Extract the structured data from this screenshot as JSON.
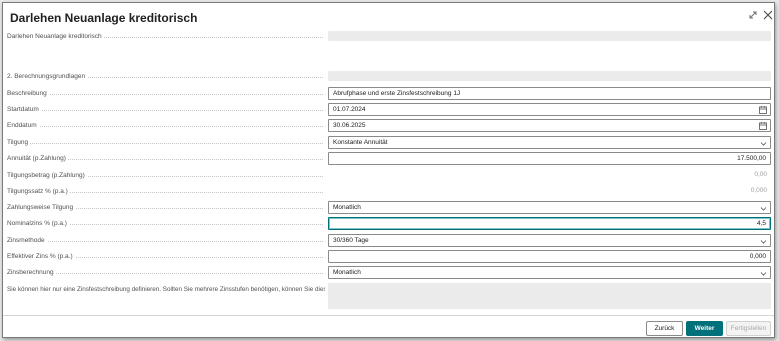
{
  "dialog": {
    "title": "Darlehen Neuanlage kreditorisch",
    "expand_icon": "expand-icon",
    "close_icon": "close-icon"
  },
  "header_field": {
    "label": "Darlehen Neuanlage kreditorisch",
    "value": ""
  },
  "section2": {
    "label": "2. Berechnungsgrundlagen",
    "value": ""
  },
  "fields": {
    "beschreibung": {
      "label": "Beschreibung",
      "value": "Abrufphase und erste Zinsfestschreibung 1J"
    },
    "startdatum": {
      "label": "Startdatum",
      "value": "01.07.2024",
      "icon": "calendar-icon"
    },
    "enddatum": {
      "label": "Enddatum",
      "value": "30.06.2025",
      "icon": "calendar-icon"
    },
    "tilgung": {
      "label": "Tilgung",
      "value": "Konstante Annuität",
      "icon": "chevron-down-icon"
    },
    "annuitaet": {
      "label": "Annuität (p.Zahlung)",
      "value": "17.500,00"
    },
    "tilgungsbetrag": {
      "label": "Tilgungsbetrag (p.Zahlung)",
      "value": "0,00"
    },
    "tilgungssatz": {
      "label": "Tilgungssatz % (p.a.)",
      "value": "0,000"
    },
    "zahlungsweise": {
      "label": "Zahlungsweise Tilgung",
      "value": "Monatlich",
      "icon": "chevron-down-icon"
    },
    "nominalzins": {
      "label": "Nominalzins % (p.a.)",
      "value": "4,5"
    },
    "zinsmethode": {
      "label": "Zinsmethode",
      "value": "30/360 Tage",
      "icon": "chevron-down-icon"
    },
    "effektiver_zins": {
      "label": "Effektiver Zins % (p.a.)",
      "value": "0,000"
    },
    "zinsberechnung": {
      "label": "Zinsberechnung",
      "value": "Monatlich",
      "icon": "chevron-down-icon"
    }
  },
  "info": {
    "text": "Sie können hier nur eine Zinsfestschreibung definieren. Sollten Sie mehrere Zinsstufen benötigen, können Sie dies n..."
  },
  "buttons": {
    "back": "Zurück",
    "next": "Weiter",
    "finish": "Fertigstellen"
  },
  "colors": {
    "accent": "#00707a",
    "readonly_bg": "#ebebeb",
    "border": "#8a8a8a"
  }
}
